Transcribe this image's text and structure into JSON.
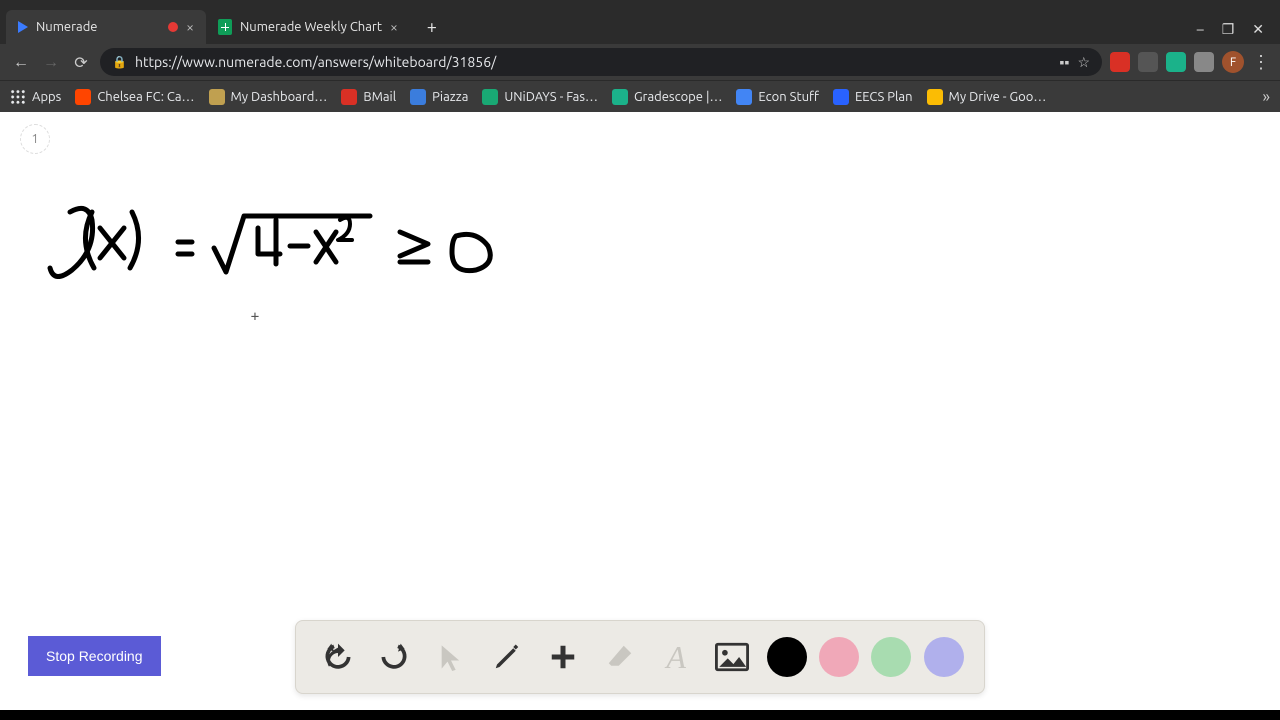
{
  "window": {
    "minimize": "–",
    "maximize": "❐",
    "close": "✕"
  },
  "tabs": [
    {
      "title": "Numerade",
      "active": true
    },
    {
      "title": "Numerade Weekly Chart",
      "active": false
    }
  ],
  "address": {
    "url": "https://www.numerade.com/answers/whiteboard/31856/",
    "profile_initial": "F"
  },
  "bookmarks": {
    "apps_label": "Apps",
    "items": [
      {
        "label": "Chelsea FC: Ca…",
        "color": "#ff4500"
      },
      {
        "label": "My Dashboard…",
        "color": "#c0a050"
      },
      {
        "label": "BMail",
        "color": "#d93025"
      },
      {
        "label": "Piazza",
        "color": "#3b7ddd"
      },
      {
        "label": "UNiDAYS - Fas…",
        "color": "#19a974"
      },
      {
        "label": "Gradescope |…",
        "color": "#1bb28a"
      },
      {
        "label": "Econ Stuff",
        "color": "#4285f4"
      },
      {
        "label": "EECS Plan",
        "color": "#2962ff"
      },
      {
        "label": "My Drive - Goo…",
        "color": "#fbbc04"
      }
    ]
  },
  "page": {
    "number": "1",
    "equation_description": "f(x) = √(4 - x²) ≥ 0"
  },
  "controls": {
    "stop_recording": "Stop Recording"
  },
  "toolbar": {
    "tools": {
      "undo": "↶",
      "redo": "↷",
      "pointer": "↖",
      "pen": "✎",
      "add": "＋",
      "eraser": "⌫",
      "text": "A",
      "image": "🖼"
    },
    "colors": [
      {
        "name": "black",
        "hex": "#000000",
        "selected": true
      },
      {
        "name": "pink",
        "hex": "#f0a8b8",
        "selected": false
      },
      {
        "name": "green",
        "hex": "#a8dcb0",
        "selected": false
      },
      {
        "name": "purple",
        "hex": "#b0b0ec",
        "selected": false
      }
    ]
  }
}
